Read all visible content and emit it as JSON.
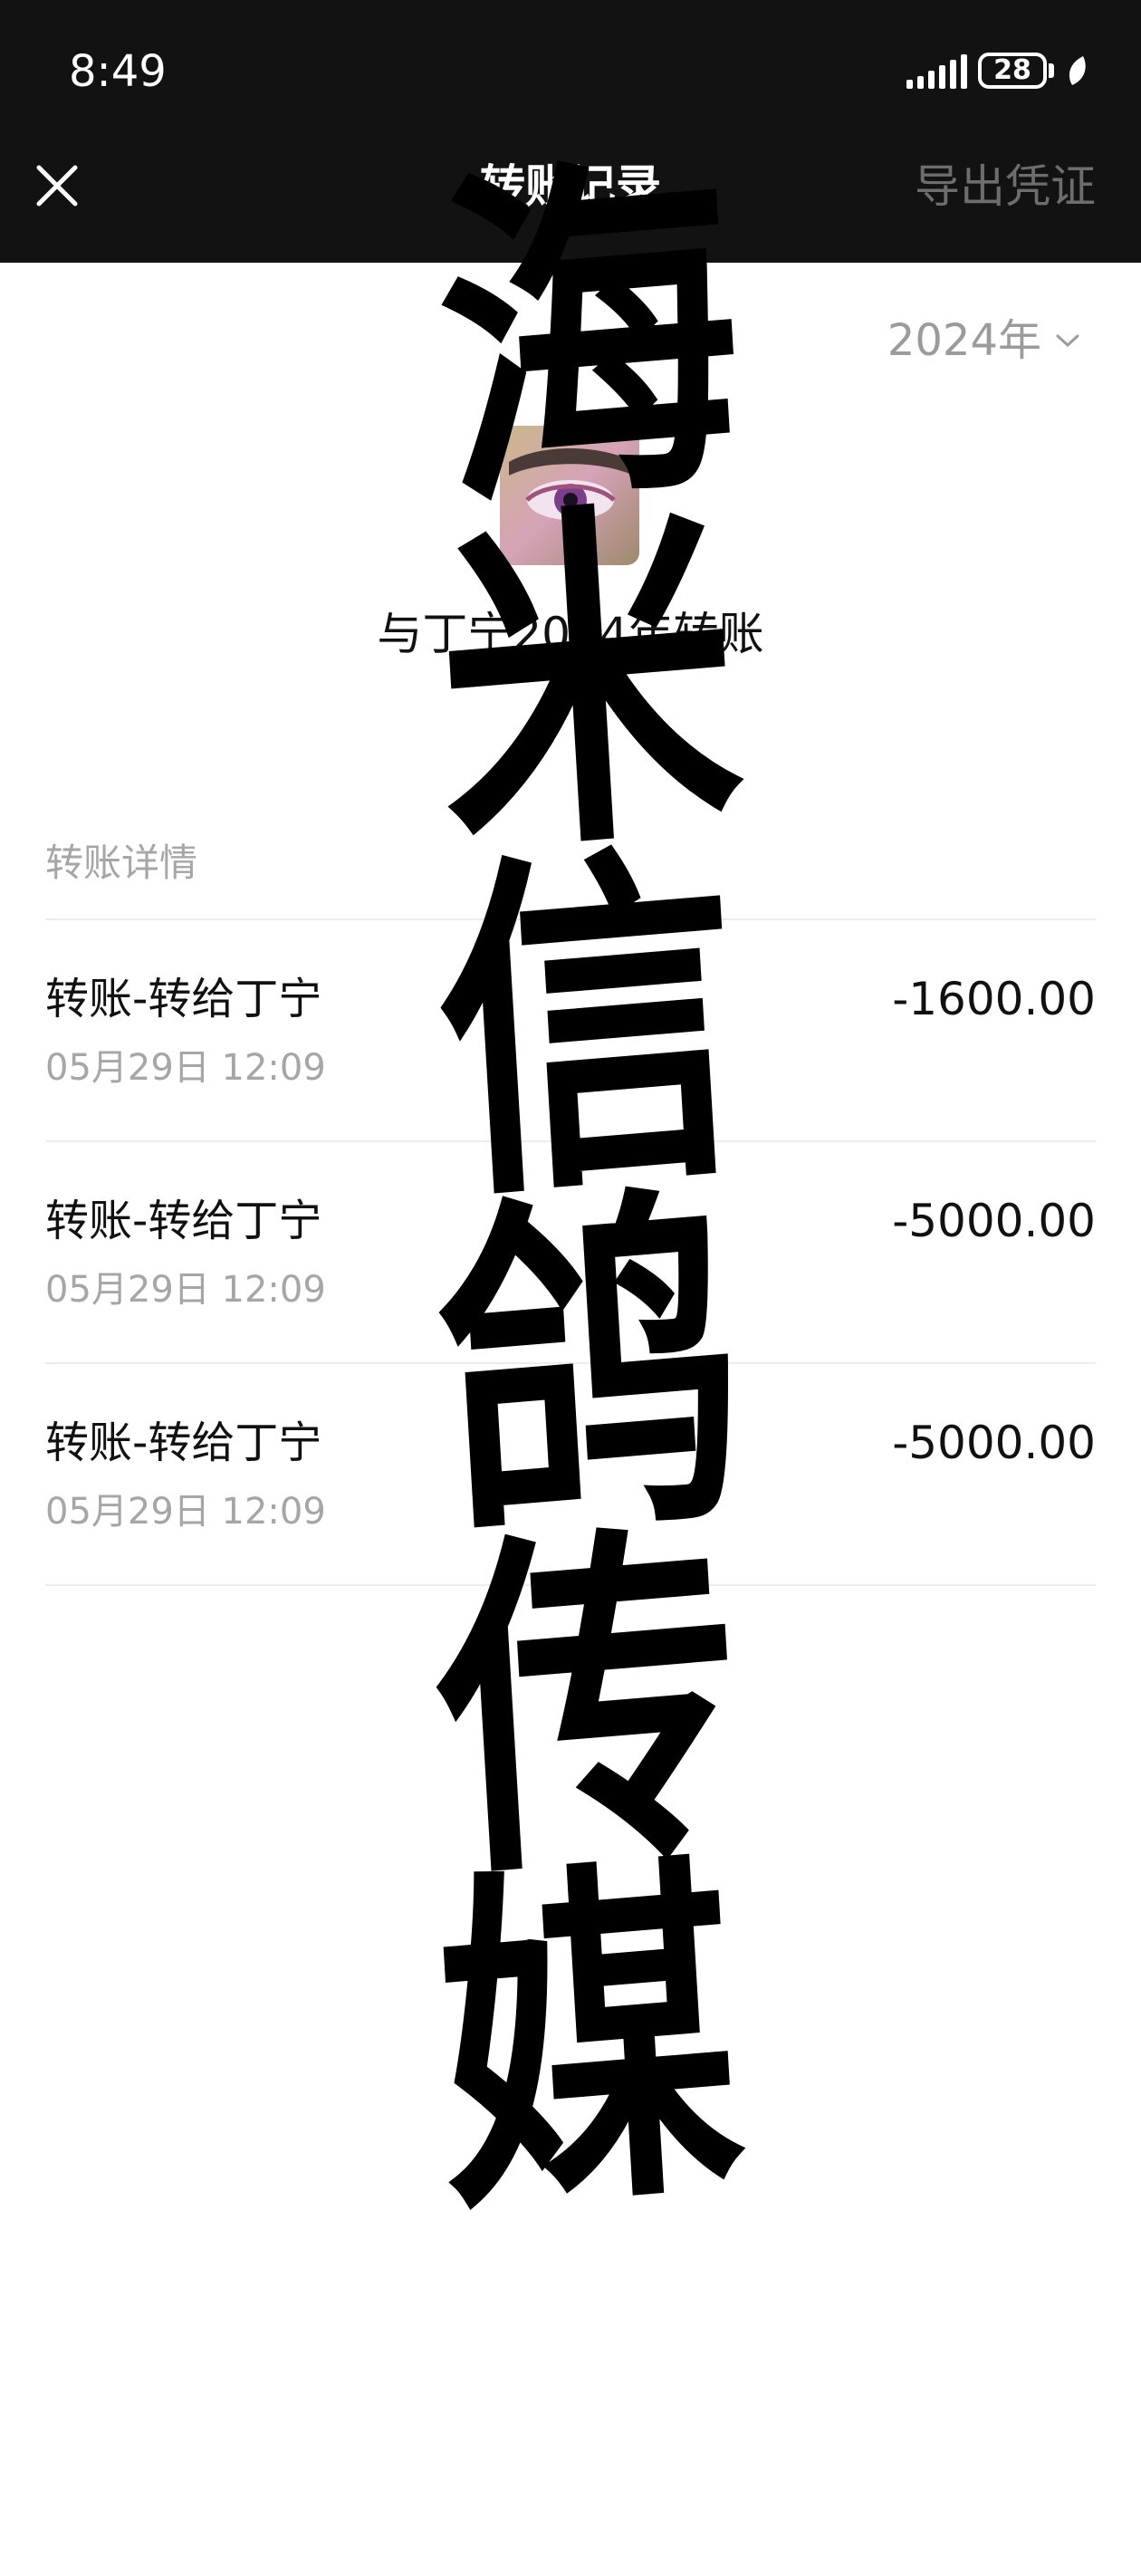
{
  "status_bar": {
    "time": "8:49",
    "battery": "28",
    "icons": [
      "signal-icon",
      "battery-icon",
      "leaf-icon"
    ]
  },
  "nav": {
    "title": "转账记录",
    "export_label": "导出凭证",
    "close_icon": "close-icon"
  },
  "filter": {
    "year_label": "2024年",
    "chevron_icon": "chevron-down-icon"
  },
  "summary": {
    "title": "与丁宁2024年转账"
  },
  "section": {
    "label": "转账详情"
  },
  "transactions": [
    {
      "title": "转账-转给丁宁",
      "time": "05月29日 12:09",
      "amount": "-1600.00"
    },
    {
      "title": "转账-转给丁宁",
      "time": "05月29日 12:09",
      "amount": "-5000.00"
    },
    {
      "title": "转账-转给丁宁",
      "time": "05月29日 12:09",
      "amount": "-5000.00"
    }
  ],
  "watermark": {
    "chars": [
      "海",
      "米",
      "信",
      "鸽",
      "传",
      "媒"
    ]
  },
  "colors": {
    "header_bg": "#121212",
    "text_primary": "#111111",
    "text_secondary": "#a6a6a6",
    "divider": "#ececec"
  }
}
